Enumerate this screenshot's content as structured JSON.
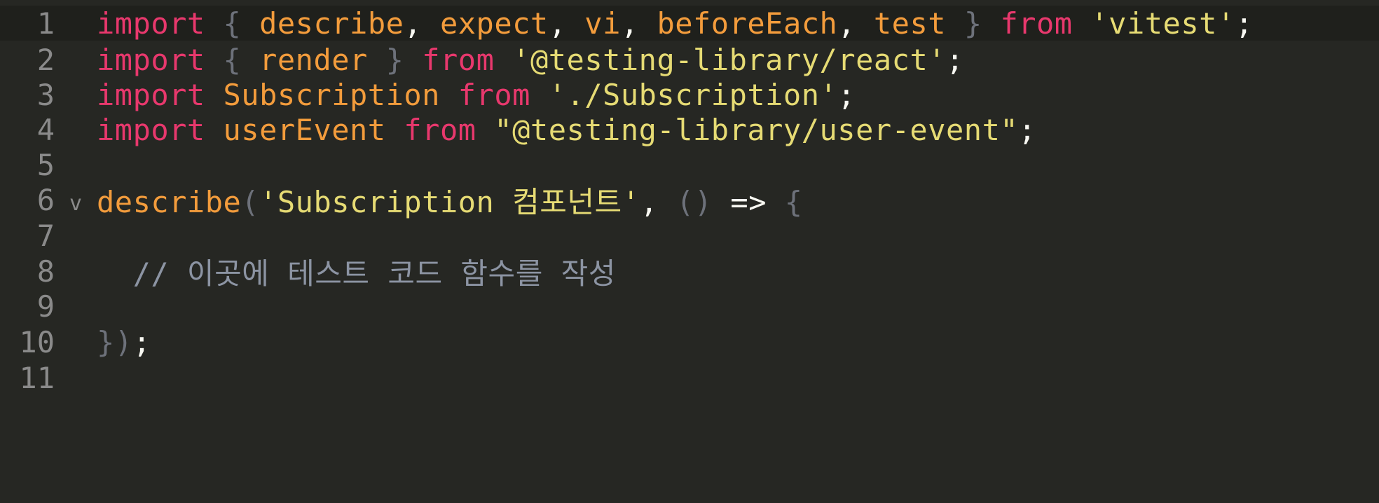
{
  "editor": {
    "active_line": 1,
    "lines": [
      {
        "num": "1",
        "tokens": [
          {
            "t": "import",
            "c": "kw"
          },
          {
            "t": " ",
            "c": "plain"
          },
          {
            "t": "{",
            "c": "punc"
          },
          {
            "t": " ",
            "c": "plain"
          },
          {
            "t": "describe",
            "c": "fn"
          },
          {
            "t": ", ",
            "c": "plain"
          },
          {
            "t": "expect",
            "c": "fn"
          },
          {
            "t": ", ",
            "c": "plain"
          },
          {
            "t": "vi",
            "c": "fn"
          },
          {
            "t": ", ",
            "c": "plain"
          },
          {
            "t": "beforeEach",
            "c": "fn"
          },
          {
            "t": ", ",
            "c": "plain"
          },
          {
            "t": "test",
            "c": "fn"
          },
          {
            "t": " ",
            "c": "plain"
          },
          {
            "t": "}",
            "c": "punc"
          },
          {
            "t": " ",
            "c": "plain"
          },
          {
            "t": "from",
            "c": "kw"
          },
          {
            "t": " ",
            "c": "plain"
          },
          {
            "t": "'vitest'",
            "c": "str"
          },
          {
            "t": ";",
            "c": "plain"
          }
        ]
      },
      {
        "num": "2",
        "tokens": [
          {
            "t": "import",
            "c": "kw"
          },
          {
            "t": " ",
            "c": "plain"
          },
          {
            "t": "{",
            "c": "punc"
          },
          {
            "t": " ",
            "c": "plain"
          },
          {
            "t": "render",
            "c": "fn"
          },
          {
            "t": " ",
            "c": "plain"
          },
          {
            "t": "}",
            "c": "punc"
          },
          {
            "t": " ",
            "c": "plain"
          },
          {
            "t": "from",
            "c": "kw"
          },
          {
            "t": " ",
            "c": "plain"
          },
          {
            "t": "'@testing-library/react'",
            "c": "str"
          },
          {
            "t": ";",
            "c": "plain"
          }
        ]
      },
      {
        "num": "3",
        "tokens": [
          {
            "t": "import",
            "c": "kw"
          },
          {
            "t": " ",
            "c": "plain"
          },
          {
            "t": "Subscription",
            "c": "fn"
          },
          {
            "t": " ",
            "c": "plain"
          },
          {
            "t": "from",
            "c": "kw"
          },
          {
            "t": " ",
            "c": "plain"
          },
          {
            "t": "'./Subscription'",
            "c": "str"
          },
          {
            "t": ";",
            "c": "plain"
          }
        ]
      },
      {
        "num": "4",
        "tokens": [
          {
            "t": "import",
            "c": "kw"
          },
          {
            "t": " ",
            "c": "plain"
          },
          {
            "t": "userEvent",
            "c": "fn"
          },
          {
            "t": " ",
            "c": "plain"
          },
          {
            "t": "from",
            "c": "kw"
          },
          {
            "t": " ",
            "c": "plain"
          },
          {
            "t": "\"@testing-library/user-event\"",
            "c": "str"
          },
          {
            "t": ";",
            "c": "plain"
          }
        ]
      },
      {
        "num": "5",
        "tokens": []
      },
      {
        "num": "6",
        "fold": "⌄",
        "tokens": [
          {
            "t": "describe",
            "c": "fn"
          },
          {
            "t": "(",
            "c": "punc"
          },
          {
            "t": "'Subscription 컴포넌트'",
            "c": "str"
          },
          {
            "t": ", ",
            "c": "plain"
          },
          {
            "t": "()",
            "c": "punc"
          },
          {
            "t": " ",
            "c": "plain"
          },
          {
            "t": "=>",
            "c": "plain"
          },
          {
            "t": " ",
            "c": "plain"
          },
          {
            "t": "{",
            "c": "punc"
          }
        ]
      },
      {
        "num": "7",
        "tokens": []
      },
      {
        "num": "8",
        "tokens": [
          {
            "t": "  // 이곳에 테스트 코드 함수를 작성",
            "c": "cmt"
          }
        ]
      },
      {
        "num": "9",
        "tokens": []
      },
      {
        "num": "10",
        "tokens": [
          {
            "t": "})",
            "c": "punc"
          },
          {
            "t": ";",
            "c": "plain"
          }
        ]
      },
      {
        "num": "11",
        "tokens": []
      }
    ]
  }
}
